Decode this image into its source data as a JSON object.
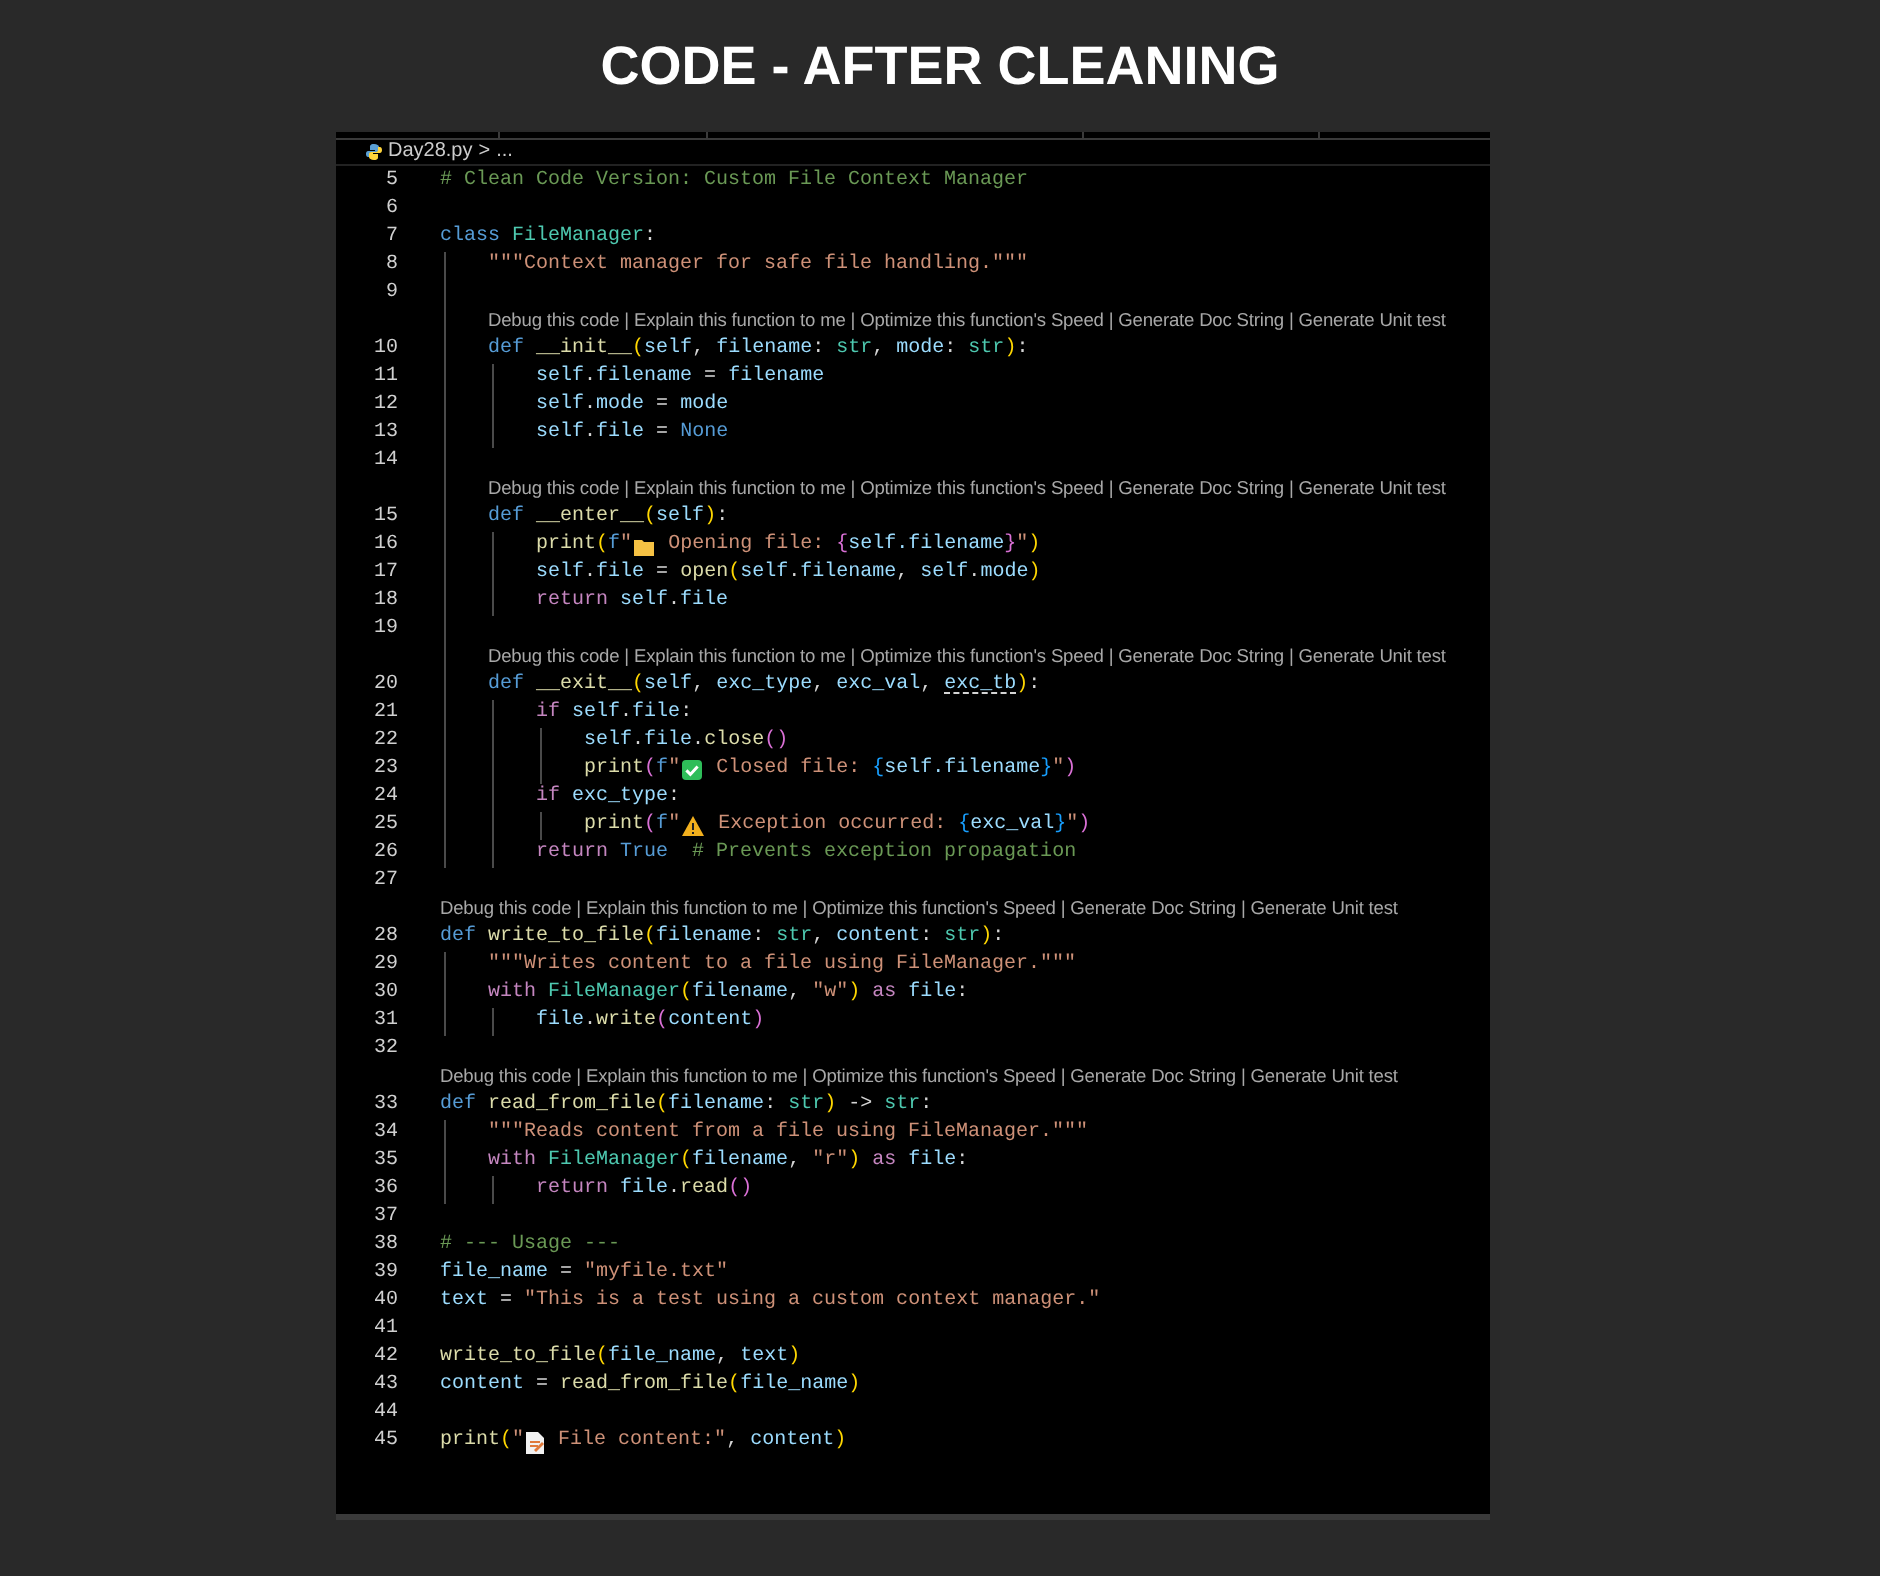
{
  "heading": "CODE - AFTER CLEANING",
  "editor": {
    "breadcrumb": {
      "file": "Day28.py",
      "separator": ">",
      "rest": "..."
    },
    "rows": [
      {
        "kind": "code",
        "number": "5",
        "tokens": [
          {
            "kind": "com",
            "text": "# Clean Code Version: Custom File Context Manager"
          }
        ]
      },
      {
        "kind": "code",
        "number": "6"
      },
      {
        "kind": "code",
        "number": "7",
        "tokens": [
          {
            "kind": "kw",
            "text": "class "
          },
          {
            "kind": "cls",
            "text": "FileManager"
          },
          {
            "kind": "pl",
            "text": ":"
          }
        ]
      },
      {
        "kind": "code",
        "number": "8",
        "tokens": [
          {
            "kind": "str",
            "text": "    \"\"\"Context manager for safe file handling.\"\"\""
          }
        ]
      },
      {
        "kind": "code",
        "number": "9"
      },
      {
        "kind": "lens",
        "text": "Debug this code | Explain this function to me | Optimize this function's Speed | Generate Doc String | Generate Unit test"
      },
      {
        "kind": "code",
        "number": "10",
        "tokens": [
          {
            "kind": "kw",
            "text": "    def "
          },
          {
            "kind": "fn",
            "text": "__init__"
          },
          {
            "kind": "p1",
            "text": "("
          },
          {
            "kind": "var",
            "text": "self"
          },
          {
            "kind": "pl",
            "text": ", "
          },
          {
            "kind": "var",
            "text": "filename"
          },
          {
            "kind": "pl",
            "text": ": "
          },
          {
            "kind": "cls",
            "text": "str"
          },
          {
            "kind": "pl",
            "text": ", "
          },
          {
            "kind": "var",
            "text": "mode"
          },
          {
            "kind": "pl",
            "text": ": "
          },
          {
            "kind": "cls",
            "text": "str"
          },
          {
            "kind": "p1",
            "text": ")"
          },
          {
            "kind": "pl",
            "text": ":"
          }
        ]
      },
      {
        "kind": "code",
        "number": "11",
        "tokens": [
          {
            "kind": "var",
            "text": "        self"
          },
          {
            "kind": "pl",
            "text": "."
          },
          {
            "kind": "var",
            "text": "filename"
          },
          {
            "kind": "pl",
            "text": " = "
          },
          {
            "kind": "var",
            "text": "filename"
          }
        ]
      },
      {
        "kind": "code",
        "number": "12",
        "tokens": [
          {
            "kind": "var",
            "text": "        self"
          },
          {
            "kind": "pl",
            "text": "."
          },
          {
            "kind": "var",
            "text": "mode"
          },
          {
            "kind": "pl",
            "text": " = "
          },
          {
            "kind": "var",
            "text": "mode"
          }
        ]
      },
      {
        "kind": "code",
        "number": "13",
        "tokens": [
          {
            "kind": "var",
            "text": "        self"
          },
          {
            "kind": "pl",
            "text": "."
          },
          {
            "kind": "var",
            "text": "file"
          },
          {
            "kind": "pl",
            "text": " = "
          },
          {
            "kind": "kw",
            "text": "None"
          }
        ]
      },
      {
        "kind": "code",
        "number": "14"
      },
      {
        "kind": "lens",
        "text": "Debug this code | Explain this function to me | Optimize this function's Speed | Generate Doc String | Generate Unit test"
      },
      {
        "kind": "code",
        "number": "15",
        "tokens": [
          {
            "kind": "kw",
            "text": "    def "
          },
          {
            "kind": "fn",
            "text": "__enter__"
          },
          {
            "kind": "p1",
            "text": "("
          },
          {
            "kind": "var",
            "text": "self"
          },
          {
            "kind": "p1",
            "text": ")"
          },
          {
            "kind": "pl",
            "text": ":"
          }
        ]
      },
      {
        "kind": "code",
        "number": "16",
        "tokens": [
          {
            "kind": "fn",
            "text": "        print"
          },
          {
            "kind": "p1",
            "text": "("
          },
          {
            "kind": "kw",
            "text": "f"
          },
          {
            "kind": "str",
            "text": "\""
          },
          {
            "kind": "folder"
          },
          {
            "kind": "str",
            "text": " Opening file: "
          },
          {
            "kind": "p2",
            "text": "{"
          },
          {
            "kind": "var",
            "text": "self.filename"
          },
          {
            "kind": "p2",
            "text": "}"
          },
          {
            "kind": "str",
            "text": "\""
          },
          {
            "kind": "p1",
            "text": ")"
          }
        ]
      },
      {
        "kind": "code",
        "number": "17",
        "tokens": [
          {
            "kind": "var",
            "text": "        self"
          },
          {
            "kind": "pl",
            "text": "."
          },
          {
            "kind": "var",
            "text": "file"
          },
          {
            "kind": "pl",
            "text": " = "
          },
          {
            "kind": "fn",
            "text": "open"
          },
          {
            "kind": "p1",
            "text": "("
          },
          {
            "kind": "var",
            "text": "self"
          },
          {
            "kind": "pl",
            "text": "."
          },
          {
            "kind": "var",
            "text": "filename"
          },
          {
            "kind": "pl",
            "text": ", "
          },
          {
            "kind": "var",
            "text": "self"
          },
          {
            "kind": "pl",
            "text": "."
          },
          {
            "kind": "var",
            "text": "mode"
          },
          {
            "kind": "p1",
            "text": ")"
          }
        ]
      },
      {
        "kind": "code",
        "number": "18",
        "tokens": [
          {
            "kind": "ctl",
            "text": "        return "
          },
          {
            "kind": "var",
            "text": "self"
          },
          {
            "kind": "pl",
            "text": "."
          },
          {
            "kind": "var",
            "text": "file"
          }
        ]
      },
      {
        "kind": "code",
        "number": "19"
      },
      {
        "kind": "lens",
        "text": "Debug this code | Explain this function to me | Optimize this function's Speed | Generate Doc String | Generate Unit test"
      },
      {
        "kind": "code",
        "number": "20",
        "tokens": [
          {
            "kind": "kw",
            "text": "    def "
          },
          {
            "kind": "fn",
            "text": "__exit__"
          },
          {
            "kind": "p1",
            "text": "("
          },
          {
            "kind": "var",
            "text": "self"
          },
          {
            "kind": "pl",
            "text": ", "
          },
          {
            "kind": "var",
            "text": "exc_type"
          },
          {
            "kind": "pl",
            "text": ", "
          },
          {
            "kind": "var",
            "text": "exc_val"
          },
          {
            "kind": "pl",
            "text": ", "
          },
          {
            "kind": "un",
            "text": "exc_tb"
          },
          {
            "kind": "p1",
            "text": ")"
          },
          {
            "kind": "pl",
            "text": ":"
          }
        ]
      },
      {
        "kind": "code",
        "number": "21",
        "tokens": [
          {
            "kind": "ctl",
            "text": "        if "
          },
          {
            "kind": "var",
            "text": "self"
          },
          {
            "kind": "pl",
            "text": "."
          },
          {
            "kind": "var",
            "text": "file"
          },
          {
            "kind": "pl",
            "text": ":"
          }
        ]
      },
      {
        "kind": "code",
        "number": "22",
        "tokens": [
          {
            "kind": "var",
            "text": "            self"
          },
          {
            "kind": "pl",
            "text": "."
          },
          {
            "kind": "var",
            "text": "file"
          },
          {
            "kind": "pl",
            "text": "."
          },
          {
            "kind": "fn",
            "text": "close"
          },
          {
            "kind": "p2",
            "text": "()"
          }
        ]
      },
      {
        "kind": "code",
        "number": "23",
        "tokens": [
          {
            "kind": "fn",
            "text": "            print"
          },
          {
            "kind": "p2",
            "text": "("
          },
          {
            "kind": "kw",
            "text": "f"
          },
          {
            "kind": "str",
            "text": "\""
          },
          {
            "kind": "check"
          },
          {
            "kind": "str",
            "text": " Closed file: "
          },
          {
            "kind": "p3",
            "text": "{"
          },
          {
            "kind": "var",
            "text": "self.filename"
          },
          {
            "kind": "p3",
            "text": "}"
          },
          {
            "kind": "str",
            "text": "\""
          },
          {
            "kind": "p2",
            "text": ")"
          }
        ]
      },
      {
        "kind": "code",
        "number": "24",
        "tokens": [
          {
            "kind": "ctl",
            "text": "        if "
          },
          {
            "kind": "var",
            "text": "exc_type"
          },
          {
            "kind": "pl",
            "text": ":"
          }
        ]
      },
      {
        "kind": "code",
        "number": "25",
        "tokens": [
          {
            "kind": "fn",
            "text": "            print"
          },
          {
            "kind": "p2",
            "text": "("
          },
          {
            "kind": "kw",
            "text": "f"
          },
          {
            "kind": "str",
            "text": "\""
          },
          {
            "kind": "warning"
          },
          {
            "kind": "str",
            "text": " Exception occurred: "
          },
          {
            "kind": "p3",
            "text": "{"
          },
          {
            "kind": "var",
            "text": "exc_val"
          },
          {
            "kind": "p3",
            "text": "}"
          },
          {
            "kind": "str",
            "text": "\""
          },
          {
            "kind": "p2",
            "text": ")"
          }
        ]
      },
      {
        "kind": "code",
        "number": "26",
        "tokens": [
          {
            "kind": "ctl",
            "text": "        return "
          },
          {
            "kind": "kw",
            "text": "True"
          },
          {
            "kind": "com",
            "text": "  # Prevents exception propagation"
          }
        ]
      },
      {
        "kind": "code",
        "number": "27"
      },
      {
        "kind": "lens",
        "text": "Debug this code | Explain this function to me | Optimize this function's Speed | Generate Doc String | Generate Unit test"
      },
      {
        "kind": "code",
        "number": "28",
        "tokens": [
          {
            "kind": "kw",
            "text": "def "
          },
          {
            "kind": "fn",
            "text": "write_to_file"
          },
          {
            "kind": "p1",
            "text": "("
          },
          {
            "kind": "var",
            "text": "filename"
          },
          {
            "kind": "pl",
            "text": ": "
          },
          {
            "kind": "cls",
            "text": "str"
          },
          {
            "kind": "pl",
            "text": ", "
          },
          {
            "kind": "var",
            "text": "content"
          },
          {
            "kind": "pl",
            "text": ": "
          },
          {
            "kind": "cls",
            "text": "str"
          },
          {
            "kind": "p1",
            "text": ")"
          },
          {
            "kind": "pl",
            "text": ":"
          }
        ]
      },
      {
        "kind": "code",
        "number": "29",
        "tokens": [
          {
            "kind": "str",
            "text": "    \"\"\"Writes content to a file using FileManager.\"\"\""
          }
        ]
      },
      {
        "kind": "code",
        "number": "30",
        "tokens": [
          {
            "kind": "ctl",
            "text": "    with "
          },
          {
            "kind": "cls",
            "text": "FileManager"
          },
          {
            "kind": "p1",
            "text": "("
          },
          {
            "kind": "var",
            "text": "filename"
          },
          {
            "kind": "pl",
            "text": ", "
          },
          {
            "kind": "str",
            "text": "\"w\""
          },
          {
            "kind": "p1",
            "text": ")"
          },
          {
            "kind": "ctl",
            "text": " as "
          },
          {
            "kind": "var",
            "text": "file"
          },
          {
            "kind": "pl",
            "text": ":"
          }
        ]
      },
      {
        "kind": "code",
        "number": "31",
        "tokens": [
          {
            "kind": "var",
            "text": "        file"
          },
          {
            "kind": "pl",
            "text": "."
          },
          {
            "kind": "fn",
            "text": "write"
          },
          {
            "kind": "p2",
            "text": "("
          },
          {
            "kind": "var",
            "text": "content"
          },
          {
            "kind": "p2",
            "text": ")"
          }
        ]
      },
      {
        "kind": "code",
        "number": "32"
      },
      {
        "kind": "lens",
        "text": "Debug this code | Explain this function to me | Optimize this function's Speed | Generate Doc String | Generate Unit test"
      },
      {
        "kind": "code",
        "number": "33",
        "tokens": [
          {
            "kind": "kw",
            "text": "def "
          },
          {
            "kind": "fn",
            "text": "read_from_file"
          },
          {
            "kind": "p1",
            "text": "("
          },
          {
            "kind": "var",
            "text": "filename"
          },
          {
            "kind": "pl",
            "text": ": "
          },
          {
            "kind": "cls",
            "text": "str"
          },
          {
            "kind": "p1",
            "text": ")"
          },
          {
            "kind": "pl",
            "text": " -> "
          },
          {
            "kind": "cls",
            "text": "str"
          },
          {
            "kind": "pl",
            "text": ":"
          }
        ]
      },
      {
        "kind": "code",
        "number": "34",
        "tokens": [
          {
            "kind": "str",
            "text": "    \"\"\"Reads content from a file using FileManager.\"\"\""
          }
        ]
      },
      {
        "kind": "code",
        "number": "35",
        "tokens": [
          {
            "kind": "ctl",
            "text": "    with "
          },
          {
            "kind": "cls",
            "text": "FileManager"
          },
          {
            "kind": "p1",
            "text": "("
          },
          {
            "kind": "var",
            "text": "filename"
          },
          {
            "kind": "pl",
            "text": ", "
          },
          {
            "kind": "str",
            "text": "\"r\""
          },
          {
            "kind": "p1",
            "text": ")"
          },
          {
            "kind": "ctl",
            "text": " as "
          },
          {
            "kind": "var",
            "text": "file"
          },
          {
            "kind": "pl",
            "text": ":"
          }
        ]
      },
      {
        "kind": "code",
        "number": "36",
        "tokens": [
          {
            "kind": "ctl",
            "text": "        return "
          },
          {
            "kind": "var",
            "text": "file"
          },
          {
            "kind": "pl",
            "text": "."
          },
          {
            "kind": "fn",
            "text": "read"
          },
          {
            "kind": "p2",
            "text": "()"
          }
        ]
      },
      {
        "kind": "code",
        "number": "37"
      },
      {
        "kind": "code",
        "number": "38",
        "tokens": [
          {
            "kind": "com",
            "text": "# --- Usage ---"
          }
        ]
      },
      {
        "kind": "code",
        "number": "39",
        "tokens": [
          {
            "kind": "var",
            "text": "file_name"
          },
          {
            "kind": "pl",
            "text": " = "
          },
          {
            "kind": "str",
            "text": "\"myfile.txt\""
          }
        ]
      },
      {
        "kind": "code",
        "number": "40",
        "tokens": [
          {
            "kind": "var",
            "text": "text"
          },
          {
            "kind": "pl",
            "text": " = "
          },
          {
            "kind": "str",
            "text": "\"This is a test using a custom context manager.\""
          }
        ]
      },
      {
        "kind": "code",
        "number": "41"
      },
      {
        "kind": "code",
        "number": "42",
        "tokens": [
          {
            "kind": "fn",
            "text": "write_to_file"
          },
          {
            "kind": "p1",
            "text": "("
          },
          {
            "kind": "var",
            "text": "file_name"
          },
          {
            "kind": "pl",
            "text": ", "
          },
          {
            "kind": "var",
            "text": "text"
          },
          {
            "kind": "p1",
            "text": ")"
          }
        ]
      },
      {
        "kind": "code",
        "number": "43",
        "tokens": [
          {
            "kind": "var",
            "text": "content"
          },
          {
            "kind": "pl",
            "text": " = "
          },
          {
            "kind": "fn",
            "text": "read_from_file"
          },
          {
            "kind": "p1",
            "text": "("
          },
          {
            "kind": "var",
            "text": "file_name"
          },
          {
            "kind": "p1",
            "text": ")"
          }
        ]
      },
      {
        "kind": "code",
        "number": "44"
      },
      {
        "kind": "code",
        "number": "45",
        "tokens": [
          {
            "kind": "fn",
            "text": "print"
          },
          {
            "kind": "p1",
            "text": "("
          },
          {
            "kind": "str",
            "text": "\""
          },
          {
            "kind": "page"
          },
          {
            "kind": "str",
            "text": " File content:\""
          },
          {
            "kind": "pl",
            "text": ", "
          },
          {
            "kind": "var",
            "text": "content"
          },
          {
            "kind": "p1",
            "text": ")"
          }
        ]
      }
    ]
  }
}
